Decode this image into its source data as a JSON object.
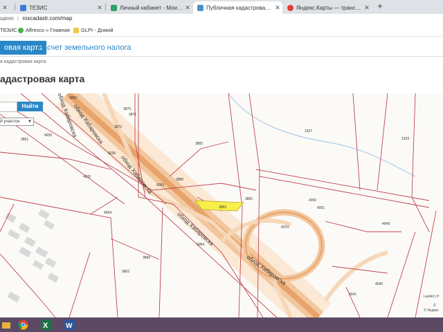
{
  "browser": {
    "tabs": [
      {
        "title": "ТЕЗИС",
        "active": false
      },
      {
        "title": "Личный кабинет - Мои объе",
        "active": false
      },
      {
        "title": "Публичная кадастровая карта",
        "active": true
      },
      {
        "title": "Яндекс.Карты — транспорт, нав",
        "active": false
      }
    ],
    "address_prefix": "щено",
    "url": "roscadastr.com/map",
    "bookmarks": [
      "ТЕЗИС",
      "Alfresco » Главная",
      "GLPI - Домой"
    ]
  },
  "site": {
    "nav_active": "овая карта",
    "nav_other": "Расчет земельного налога",
    "breadcrumb": "я кадастровая карта",
    "page_title": "адастровая карта",
    "find_button": "Найти",
    "type_select": "й участок"
  },
  "map": {
    "parcels": [
      "4935",
      "6035",
      "4935",
      "4934",
      "3890",
      "3862",
      "3882",
      "3880",
      "6083",
      "3892",
      "3881",
      "6084",
      "1527",
      "1533",
      "4050",
      "4051",
      "6070",
      "4049",
      "4040",
      "4041",
      "3870",
      "3871",
      "3872",
      "3861",
      "3882"
    ],
    "roads": [
      "обход Хабаровска",
      "обход Хабаровска",
      "обход Хабаровска",
      "обход Хабаровска",
      "обход Хабаровска"
    ],
    "attribution_1": "Leaflet | Р",
    "attribution_2": "© Яндекс",
    "attribution_3": "д"
  },
  "colors": {
    "accent": "#2a87c7",
    "parcel_line": "#c0434f",
    "road": "#e8a36a",
    "highlight": "#f7ef4a",
    "taskbar": "#5c4a64"
  }
}
